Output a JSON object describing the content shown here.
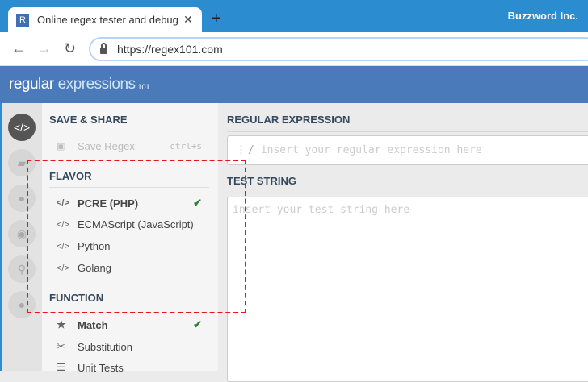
{
  "browser": {
    "tab_favicon": "R",
    "tab_title": "Online regex tester and debugger",
    "new_tab": "+",
    "profile": "Buzzword Inc.",
    "url": "https://regex101.com"
  },
  "header": {
    "logo_part1": "regular",
    "logo_part2": "expressions",
    "logo_part3": "101"
  },
  "icon_nav": [
    "code-icon",
    "book-icon",
    "user-icon",
    "gamepad-icon",
    "wrench-icon",
    "chat-icon"
  ],
  "sidebar": {
    "save_share": {
      "title": "SAVE & SHARE",
      "save_label": "Save Regex",
      "save_shortcut": "ctrl+s"
    },
    "flavor": {
      "title": "FLAVOR",
      "items": [
        {
          "label": "PCRE (PHP)",
          "selected": true
        },
        {
          "label": "ECMAScript (JavaScript)"
        },
        {
          "label": "Python"
        },
        {
          "label": "Golang"
        }
      ]
    },
    "function": {
      "title": "FUNCTION",
      "items": [
        {
          "label": "Match",
          "selected": true
        },
        {
          "label": "Substitution"
        },
        {
          "label": "Unit Tests"
        }
      ]
    },
    "check": "✔"
  },
  "main": {
    "regex_title": "REGULAR EXPRESSION",
    "regex_delim": "/",
    "regex_placeholder": "insert your regular expression here",
    "test_title": "TEST STRING",
    "test_placeholder": "insert your test string here"
  },
  "colors": {
    "tabbar": "#2b8dcf",
    "header": "#4a7ab9",
    "highlight": "#e8141b",
    "check": "#2e7d32"
  }
}
